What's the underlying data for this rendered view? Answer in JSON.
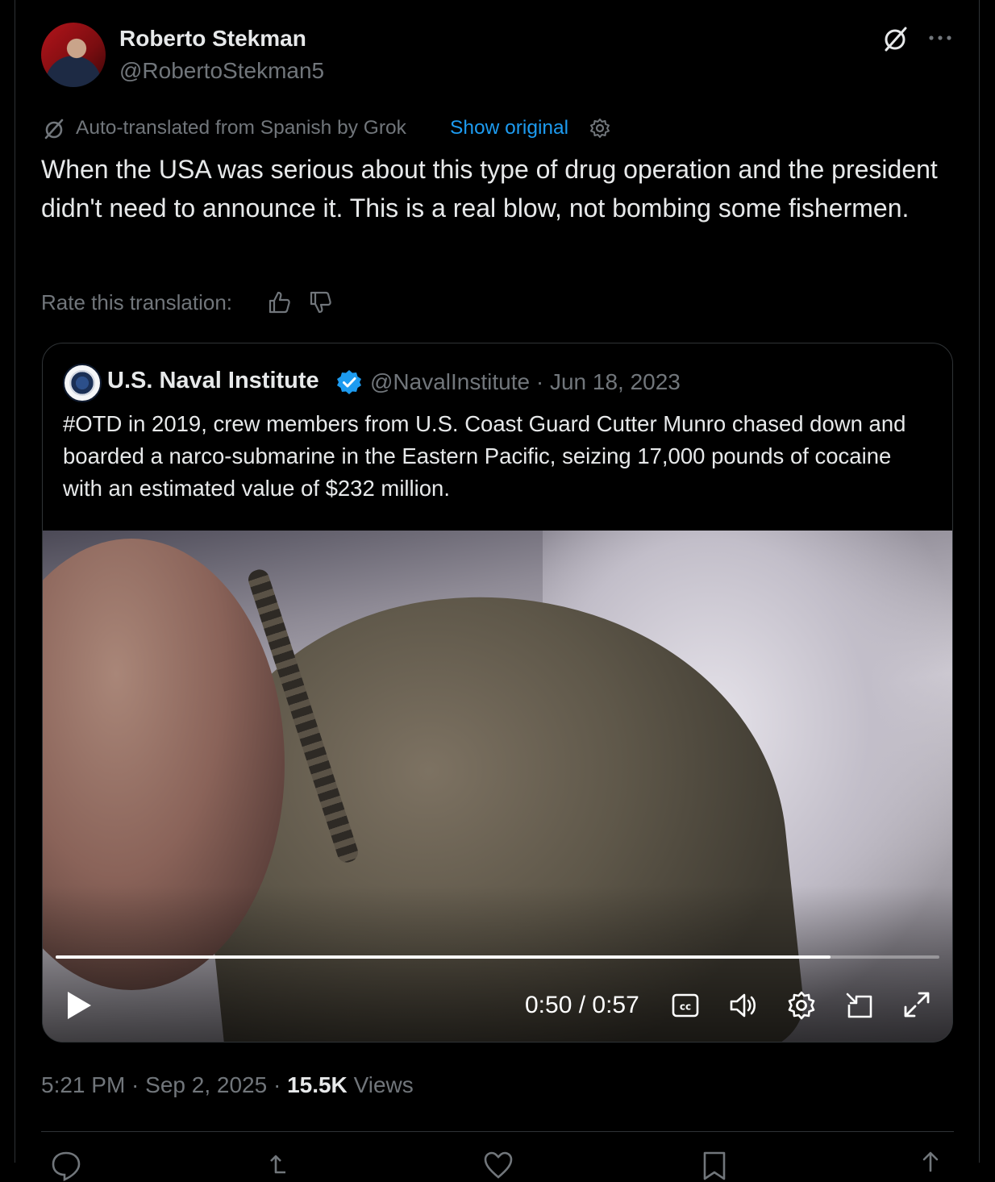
{
  "author": {
    "name": "Roberto Stekman",
    "handle": "@RobertoStekman5"
  },
  "icons": {
    "grok": "grok-icon",
    "more": "more-icon",
    "settings": "gear-icon",
    "thumbs_up": "thumbs-up-icon",
    "thumbs_down": "thumbs-down-icon",
    "verified": "verified-badge-icon",
    "play": "play-icon",
    "captions": "captions-icon",
    "volume": "volume-icon",
    "pip": "pip-icon",
    "fullscreen": "fullscreen-icon"
  },
  "translation": {
    "notice": "Auto-translated from Spanish by Grok",
    "show_original": "Show original",
    "rate_label": "Rate this translation:"
  },
  "post": {
    "text": "When the USA was serious about this type of drug operation and the president didn't need to announce it. This is a real blow, not bombing some fishermen."
  },
  "quote": {
    "name": "U.S. Naval Institute",
    "meta": "@NavalInstitute · Jun 18, 2023",
    "text": "#OTD in 2019, crew members from U.S. Coast Guard Cutter Munro chased down and boarded a narco-submarine in the Eastern Pacific, seizing 17,000 pounds of cocaine with an estimated value of $232 million."
  },
  "video": {
    "time": "0:50 / 0:57",
    "progress": 0.877
  },
  "footer": {
    "time": "5:21 PM · Sep 2, 2025 · ",
    "views_count": "15.5K",
    "views_label": "Views"
  },
  "colors": {
    "background": "#000000",
    "text": "#e7e9ea",
    "secondary": "#71767b",
    "link": "#1d9bf0",
    "border": "#2f3336"
  }
}
